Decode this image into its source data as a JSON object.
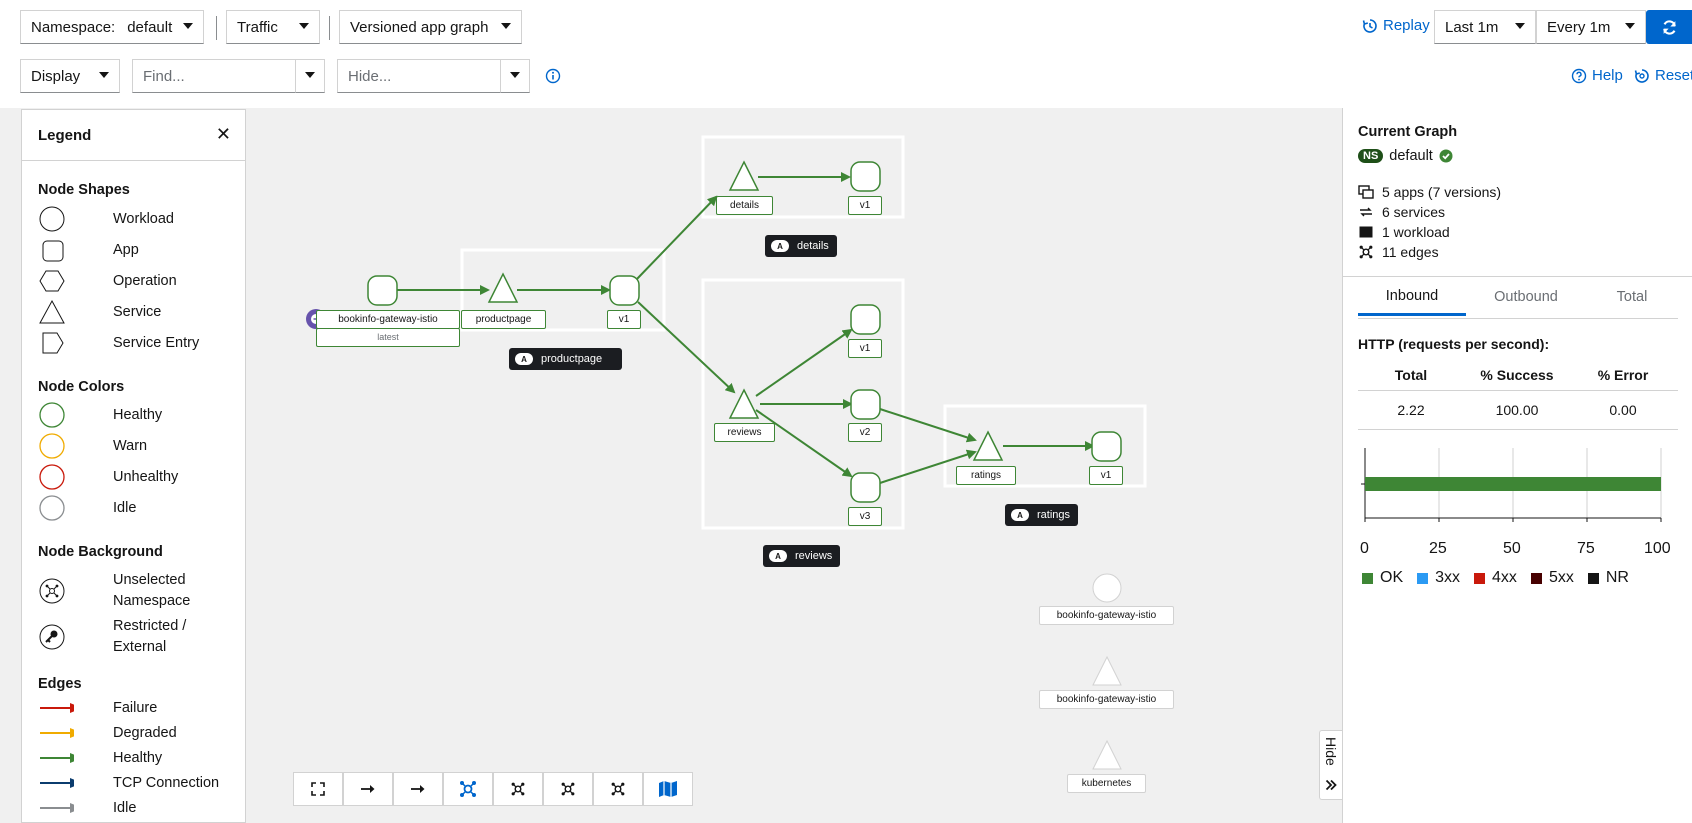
{
  "toolbar": {
    "namespace_label": "Namespace:",
    "namespace_value": "default",
    "traffic_label": "Traffic",
    "graph_type": "Versioned app graph",
    "replay_label": "Replay",
    "duration": "Last 1m",
    "refresh_interval": "Every 1m",
    "display_label": "Display",
    "find_placeholder": "Find...",
    "hide_placeholder": "Hide...",
    "help_label": "Help",
    "reset_label": "Reset"
  },
  "legend": {
    "title": "Legend",
    "node_shapes_title": "Node Shapes",
    "node_shapes": [
      "Workload",
      "App",
      "Operation",
      "Service",
      "Service Entry"
    ],
    "node_colors_title": "Node Colors",
    "node_colors": [
      {
        "label": "Healthy",
        "color": "#3e8635"
      },
      {
        "label": "Warn",
        "color": "#f0ab00"
      },
      {
        "label": "Unhealthy",
        "color": "#c9190b"
      },
      {
        "label": "Idle",
        "color": "#8a8d90"
      }
    ],
    "node_background_title": "Node Background",
    "node_background": [
      "Unselected Namespace",
      "Restricted / External"
    ],
    "edges_title": "Edges",
    "edges": [
      {
        "label": "Failure",
        "color": "#c9190b"
      },
      {
        "label": "Degraded",
        "color": "#f0ab00"
      },
      {
        "label": "Healthy",
        "color": "#3e8635"
      },
      {
        "label": "TCP Connection",
        "color": "#0b3c6e"
      },
      {
        "label": "Idle",
        "color": "#8a8d90"
      }
    ]
  },
  "graph": {
    "nodes": {
      "gateway": "bookinfo-gateway-istio",
      "gateway_version": "latest",
      "productpage": "productpage",
      "productpage_v1": "v1",
      "details": "details",
      "details_v1": "v1",
      "reviews": "reviews",
      "reviews_v1": "v1",
      "reviews_v2": "v2",
      "reviews_v3": "v3",
      "ratings": "ratings",
      "ratings_v1": "v1",
      "idle_workload": "bookinfo-gateway-istio",
      "idle_service": "bookinfo-gateway-istio",
      "kubernetes": "kubernetes"
    },
    "app_boxes": {
      "badge": "A",
      "details": "details",
      "productpage": "productpage",
      "reviews": "reviews",
      "ratings": "ratings"
    },
    "hide_tab": "Hide"
  },
  "side_panel": {
    "title": "Current Graph",
    "ns_badge": "NS",
    "namespace": "default",
    "stats": [
      "5 apps (7 versions)",
      "6 services",
      "1 workload",
      "11 edges"
    ],
    "tabs": [
      "Inbound",
      "Outbound",
      "Total"
    ],
    "active_tab": "Inbound",
    "http_title": "HTTP (requests per second):",
    "table_headers": [
      "Total",
      "% Success",
      "% Error"
    ],
    "table_values": [
      "2.22",
      "100.00",
      "0.00"
    ],
    "bar_ticks": [
      "0",
      "25",
      "50",
      "75",
      "100"
    ],
    "ok_percent": 100,
    "bar_legend": [
      {
        "label": "OK",
        "color": "#3e8635"
      },
      {
        "label": "3xx",
        "color": "#2b9af3"
      },
      {
        "label": "4xx",
        "color": "#c9190b"
      },
      {
        "label": "5xx",
        "color": "#470000"
      },
      {
        "label": "NR",
        "color": "#151515"
      }
    ]
  },
  "colors": {
    "healthy": "#3e8635",
    "accent": "#0066cc",
    "primary_button": "#0066cc"
  }
}
